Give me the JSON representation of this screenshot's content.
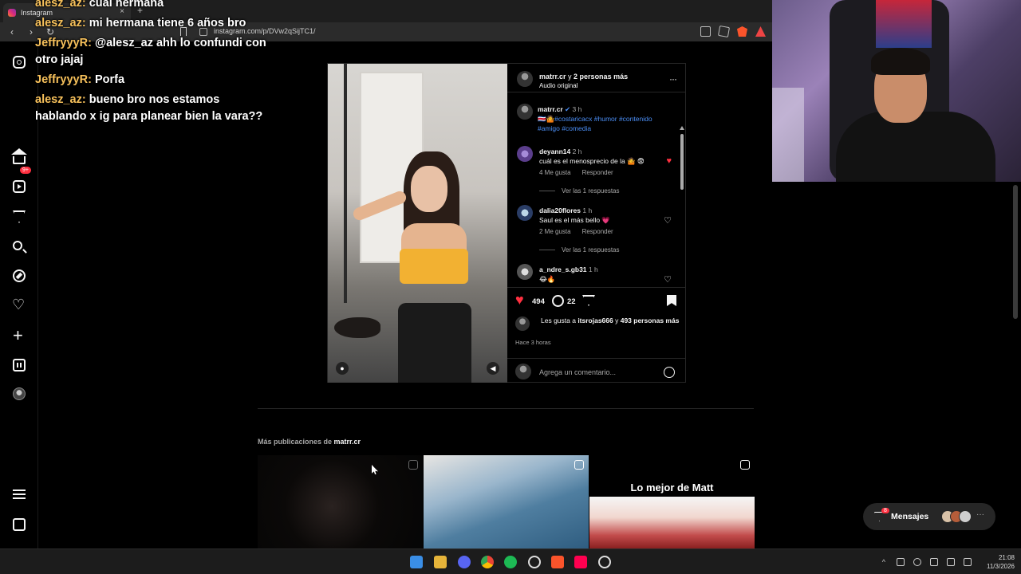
{
  "browser": {
    "tab_title": "Instagram",
    "tab_close": "×",
    "new_tab": "+",
    "back": "‹",
    "forward": "›",
    "reload": "↻",
    "url": "instagram.com/p/DVw2qSijTC1/"
  },
  "chat": [
    {
      "user": "alesz_az:",
      "text": "cual hermana"
    },
    {
      "user": "alesz_az:",
      "text": "mi hermana tiene 6 años bro"
    },
    {
      "user": "JeffryyyR:",
      "text": "@alesz_az ahh lo confundi con otro jajaj"
    },
    {
      "user": "JeffryyyR:",
      "text": "Porfa"
    },
    {
      "user": "alesz_az:",
      "text": "bueno bro nos estamos hablando x ig para planear bien la vara??"
    }
  ],
  "sidebar": {
    "badge": "9+"
  },
  "post": {
    "header_name": "matrr.cr",
    "header_connector": " y ",
    "header_others": "2 personas más",
    "header_audio": "Audio original",
    "menu": "···",
    "caption": {
      "user": "matrr.cr",
      "time": "3 h",
      "emoji": "🇨🇷🤷",
      "tags": "#costaricacx #humor #contenido #amigo #comedia"
    },
    "comments": [
      {
        "user": "deyann14",
        "time": "2 h",
        "text": "cuál es el menosprecio de la 🤷 😨",
        "likes": "4 Me gusta",
        "reply": "Responder",
        "view_replies": "Ver las 1 respuestas",
        "liked": true
      },
      {
        "user": "dalia20flores",
        "time": "1 h",
        "text": "Saul es el más bello 💗",
        "likes": "2 Me gusta",
        "reply": "Responder",
        "view_replies": "Ver las 1 respuestas",
        "liked": false
      },
      {
        "user": "a_ndre_s.gb31",
        "time": "1 h",
        "text": "😂🔥",
        "likes": "",
        "reply": "",
        "view_replies": "",
        "liked": false
      }
    ],
    "like_count": "494",
    "comment_count": "22",
    "likes_prefix": "Les gusta a ",
    "likes_user": "itsrojas666",
    "likes_connector": " y ",
    "likes_others": "493 personas más",
    "time_ago": "Hace 3 horas",
    "comment_placeholder": "Agrega un comentario..."
  },
  "more": {
    "prefix": "Más publicaciones de ",
    "user": "matrr.cr",
    "thumb3_title": "Lo mejor de Matt"
  },
  "messages": {
    "label": "Mensajes",
    "badge": "8",
    "more": "···"
  },
  "taskbar": {
    "time": "21:08",
    "date": "11/3/2026",
    "tray_caret": "^"
  }
}
